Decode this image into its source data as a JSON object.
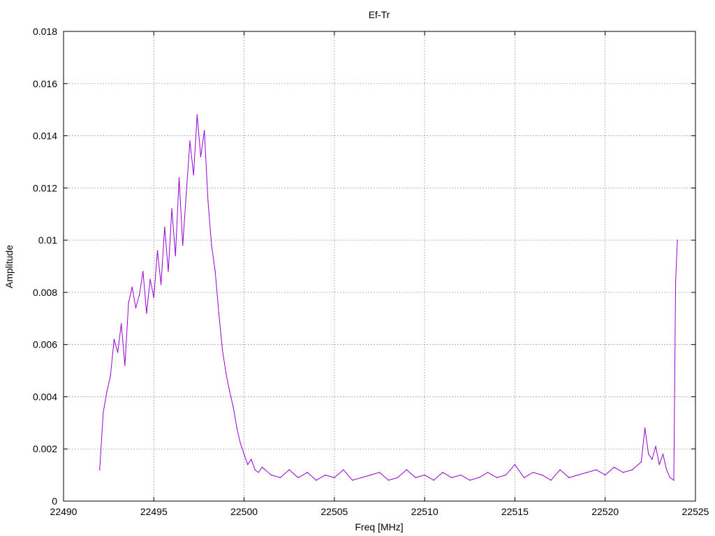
{
  "chart_data": {
    "type": "line",
    "title": "Ef-Tr",
    "xlabel": "Freq [MHz]",
    "ylabel": "Amplitude",
    "xlim": [
      22490,
      22525
    ],
    "ylim": [
      0,
      0.018
    ],
    "x_ticks": [
      22490,
      22495,
      22500,
      22505,
      22510,
      22515,
      22520,
      22525
    ],
    "y_ticks": [
      0,
      0.002,
      0.004,
      0.006,
      0.008,
      0.01,
      0.012,
      0.014,
      0.016,
      0.018
    ],
    "x_tick_labels": [
      "22490",
      "22495",
      "22500",
      "22505",
      "22510",
      "22515",
      "22520",
      "22525"
    ],
    "y_tick_labels": [
      "0",
      "0.002",
      "0.004",
      "0.006",
      "0.008",
      "0.01",
      "0.012",
      "0.014",
      "0.016",
      "0.018"
    ],
    "grid": true,
    "legend": "none",
    "series": [
      {
        "color": "#9400d3",
        "x": [
          22492.0,
          22492.2,
          22492.4,
          22492.6,
          22492.8,
          22493.0,
          22493.2,
          22493.4,
          22493.6,
          22493.8,
          22494.0,
          22494.2,
          22494.4,
          22494.6,
          22494.8,
          22495.0,
          22495.2,
          22495.4,
          22495.6,
          22495.8,
          22496.0,
          22496.2,
          22496.4,
          22496.6,
          22496.8,
          22497.0,
          22497.2,
          22497.4,
          22497.6,
          22497.8,
          22498.0,
          22498.2,
          22498.4,
          22498.6,
          22498.8,
          22499.0,
          22499.2,
          22499.4,
          22499.6,
          22499.8,
          22500.0,
          22500.2,
          22500.4,
          22500.6,
          22500.8,
          22501.0,
          22501.5,
          22502.0,
          22502.5,
          22503.0,
          22503.5,
          22504.0,
          22504.5,
          22505.0,
          22505.5,
          22506.0,
          22506.5,
          22507.0,
          22507.5,
          22508.0,
          22508.5,
          22509.0,
          22509.5,
          22510.0,
          22510.5,
          22511.0,
          22511.5,
          22512.0,
          22512.5,
          22513.0,
          22513.5,
          22514.0,
          22514.5,
          22515.0,
          22515.5,
          22516.0,
          22516.5,
          22517.0,
          22517.5,
          22518.0,
          22518.5,
          22519.0,
          22519.5,
          22520.0,
          22520.5,
          22521.0,
          22521.5,
          22522.0,
          22522.2,
          22522.4,
          22522.6,
          22522.8,
          22523.0,
          22523.2,
          22523.4,
          22523.6,
          22523.8,
          22523.9,
          22524.0
        ],
        "y": [
          0.0012,
          0.0034,
          0.0042,
          0.0048,
          0.0062,
          0.0057,
          0.0068,
          0.0052,
          0.0076,
          0.0082,
          0.0074,
          0.0079,
          0.0088,
          0.0072,
          0.0085,
          0.0078,
          0.0096,
          0.0083,
          0.0105,
          0.0088,
          0.0112,
          0.0094,
          0.0124,
          0.0098,
          0.0118,
          0.0138,
          0.0125,
          0.0148,
          0.0132,
          0.0142,
          0.0115,
          0.0098,
          0.0088,
          0.0072,
          0.0058,
          0.0049,
          0.0042,
          0.0036,
          0.0028,
          0.0022,
          0.0018,
          0.0014,
          0.0016,
          0.0012,
          0.0011,
          0.0013,
          0.001,
          0.0009,
          0.0012,
          0.0009,
          0.0011,
          0.0008,
          0.001,
          0.0009,
          0.0012,
          0.0008,
          0.0009,
          0.001,
          0.0011,
          0.0008,
          0.0009,
          0.0012,
          0.0009,
          0.001,
          0.0008,
          0.0011,
          0.0009,
          0.001,
          0.0008,
          0.0009,
          0.0011,
          0.0009,
          0.001,
          0.0014,
          0.0009,
          0.0011,
          0.001,
          0.0008,
          0.0012,
          0.0009,
          0.001,
          0.0011,
          0.0012,
          0.001,
          0.0013,
          0.0011,
          0.0012,
          0.0015,
          0.0028,
          0.0018,
          0.0016,
          0.0021,
          0.0014,
          0.0018,
          0.0012,
          0.0009,
          0.0008,
          0.0084,
          0.01
        ]
      }
    ]
  }
}
